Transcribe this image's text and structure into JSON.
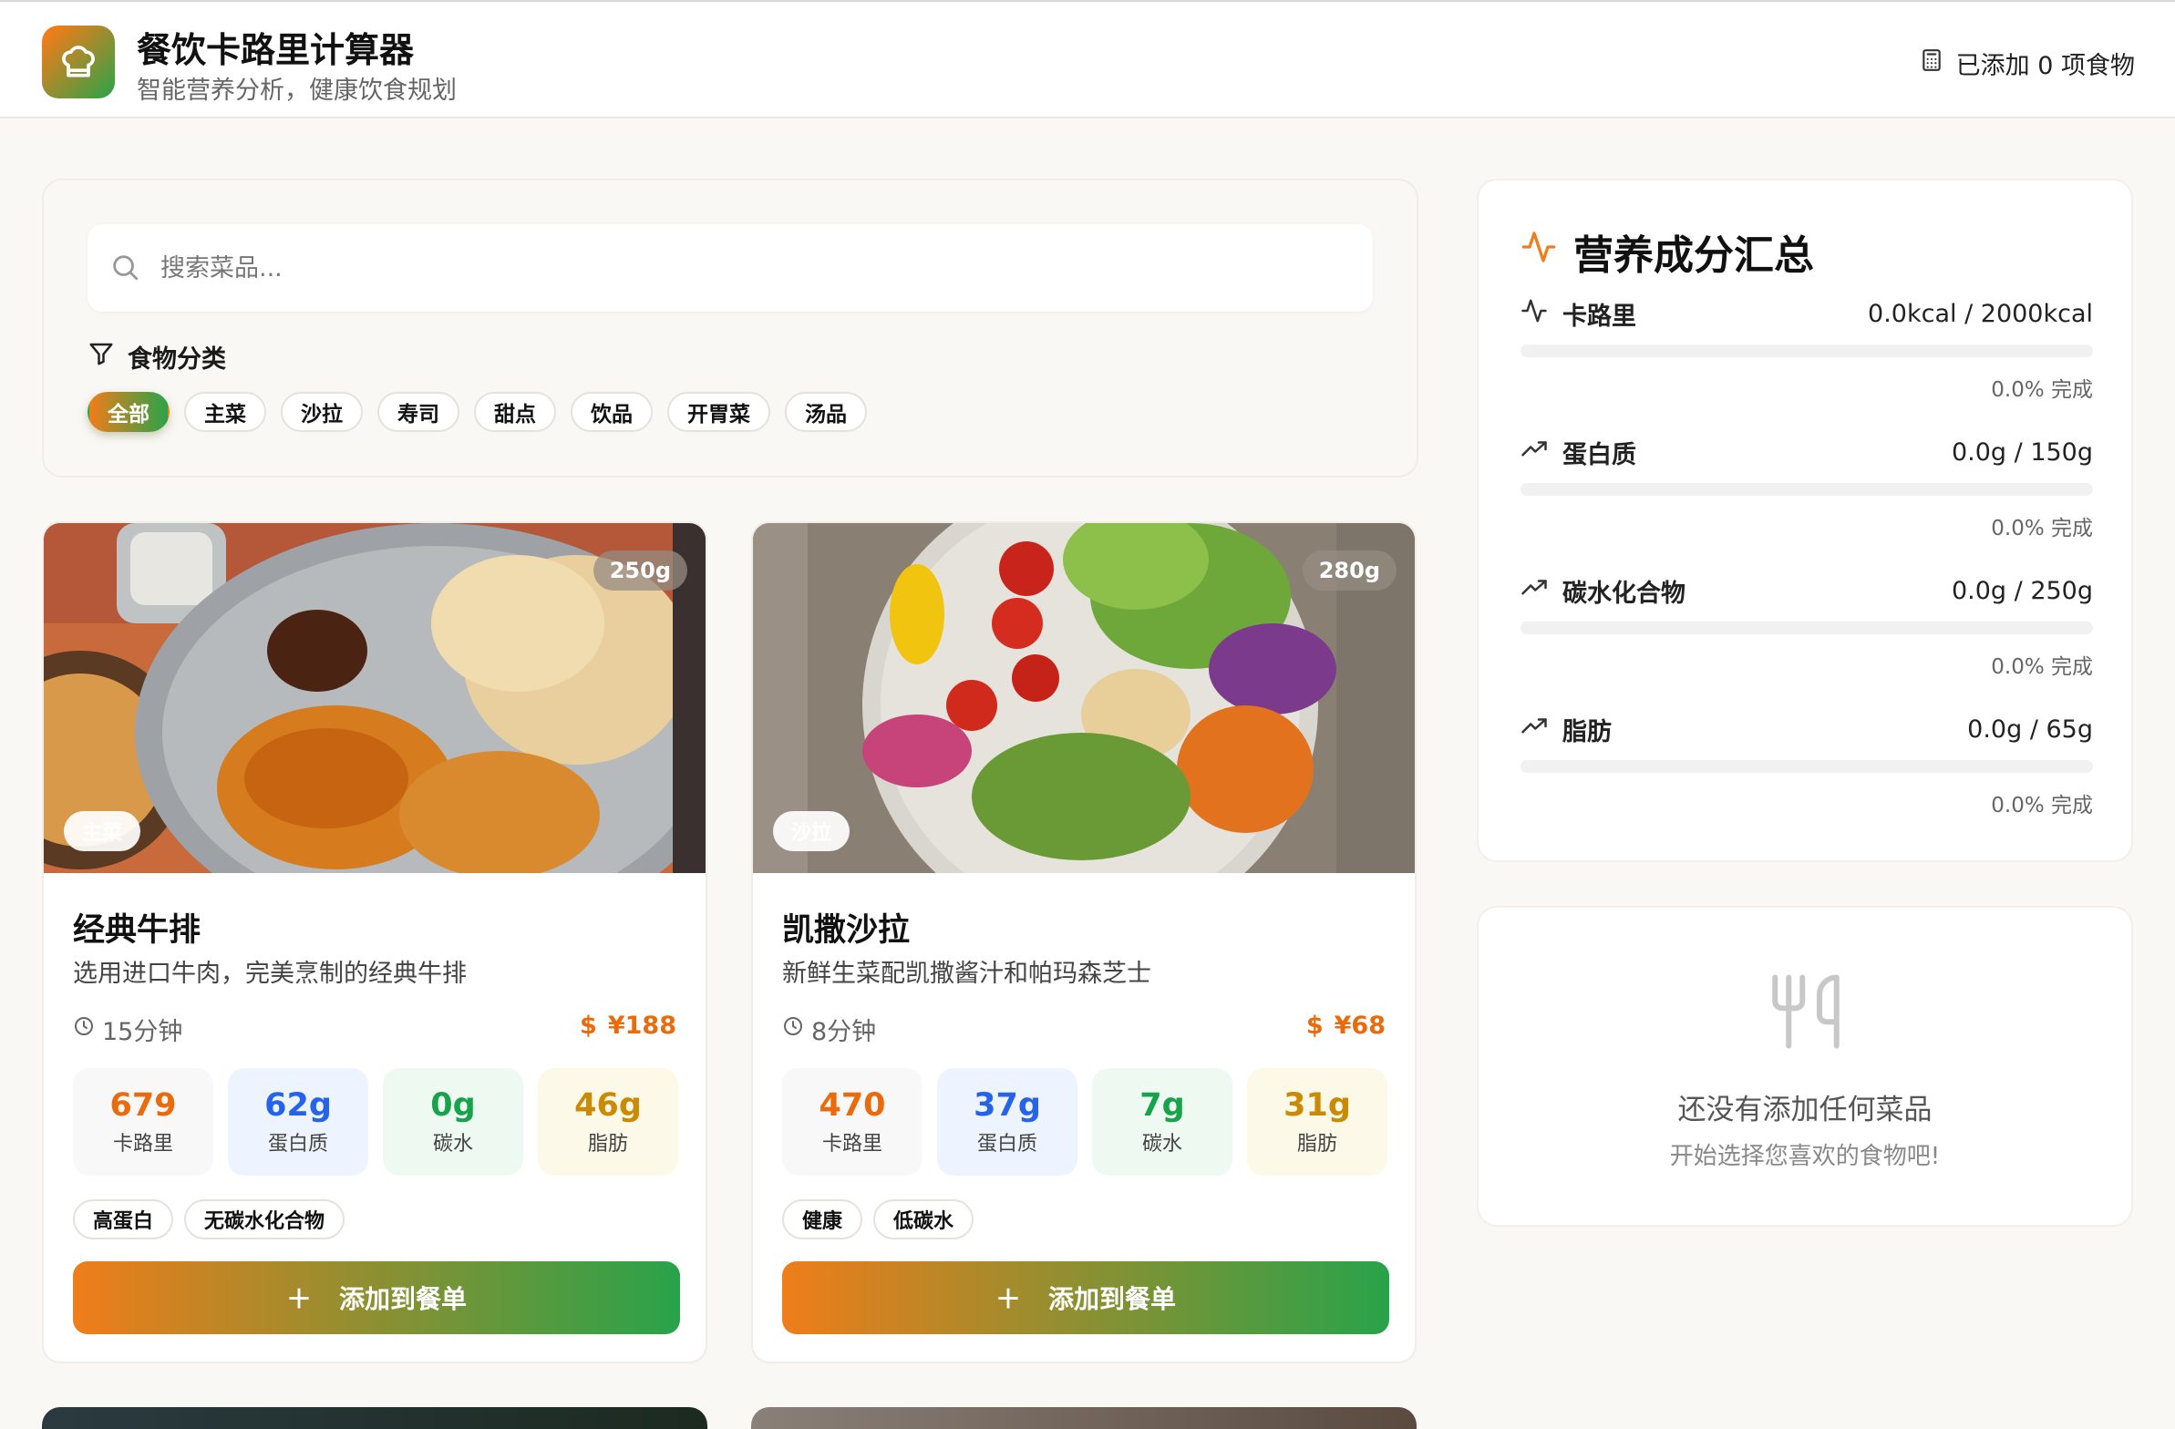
{
  "header": {
    "title": "餐饮卡路里计算器",
    "subtitle": "智能营养分析，健康饮食规划",
    "added_label": "已添加 0 项食物"
  },
  "search": {
    "placeholder": "搜索菜品..."
  },
  "categories": {
    "title": "食物分类",
    "items": [
      "全部",
      "主菜",
      "沙拉",
      "寿司",
      "甜点",
      "饮品",
      "开胃菜",
      "汤品"
    ],
    "active": "全部"
  },
  "dishes": [
    {
      "name": "经典牛排",
      "description": "选用进口牛肉，完美烹制的经典牛排",
      "weight": "250g",
      "category": "主菜",
      "time": "15分钟",
      "price": "¥188",
      "calories": "679",
      "calories_label": "卡路里",
      "protein": "62g",
      "protein_label": "蛋白质",
      "carbs": "0g",
      "carbs_label": "碳水",
      "fat": "46g",
      "fat_label": "脂肪",
      "tags": [
        "高蛋白",
        "无碳水化合物"
      ],
      "add_label": "添加到餐单"
    },
    {
      "name": "凯撒沙拉",
      "description": "新鲜生菜配凯撒酱汁和帕玛森芝士",
      "weight": "280g",
      "category": "沙拉",
      "time": "8分钟",
      "price": "¥68",
      "calories": "470",
      "calories_label": "卡路里",
      "protein": "37g",
      "protein_label": "蛋白质",
      "carbs": "7g",
      "carbs_label": "碳水",
      "fat": "31g",
      "fat_label": "脂肪",
      "tags": [
        "健康",
        "低碳水"
      ],
      "add_label": "添加到餐单"
    }
  ],
  "summary": {
    "title": "营养成分汇总",
    "rows": [
      {
        "label": "卡路里",
        "value": "0.0kcal / 2000kcal",
        "percent": "0.0% 完成",
        "progress": 0
      },
      {
        "label": "蛋白质",
        "value": "0.0g / 150g",
        "percent": "0.0% 完成",
        "progress": 0
      },
      {
        "label": "碳水化合物",
        "value": "0.0g / 250g",
        "percent": "0.0% 完成",
        "progress": 0
      },
      {
        "label": "脂肪",
        "value": "0.0g / 65g",
        "percent": "0.0% 完成",
        "progress": 0
      }
    ]
  },
  "empty_state": {
    "title": "还没有添加任何菜品",
    "subtitle": "开始选择您喜欢的食物吧!"
  },
  "colors": {
    "accent_orange": "#ef7d1a",
    "accent_green": "#2aa34a",
    "calories": "#ea6a0c",
    "protein": "#2563eb",
    "carbs": "#16a34a",
    "fat": "#ca8a04"
  }
}
